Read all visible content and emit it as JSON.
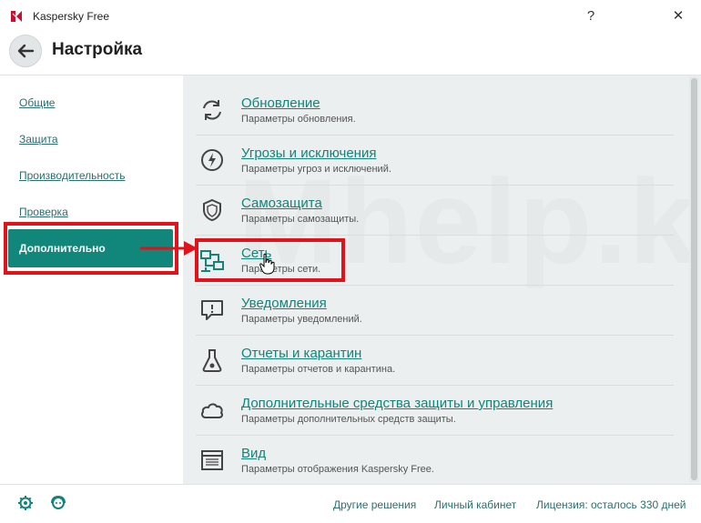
{
  "window": {
    "app_title": "Kaspersky Free",
    "help": "?",
    "close": "✕"
  },
  "header": {
    "title": "Настройка"
  },
  "sidebar": {
    "items": [
      {
        "label": "Общие"
      },
      {
        "label": "Защита"
      },
      {
        "label": "Производительность"
      },
      {
        "label": "Проверка"
      },
      {
        "label": "Дополнительно",
        "selected": true
      }
    ]
  },
  "settings": {
    "items": [
      {
        "title": "Обновление",
        "subtitle": "Параметры обновления.",
        "icon": "refresh-icon"
      },
      {
        "title": "Угрозы и исключения",
        "subtitle": "Параметры угроз и исключений.",
        "icon": "lightning-icon"
      },
      {
        "title": "Самозащита",
        "subtitle": "Параметры самозащиты.",
        "icon": "shield-icon"
      },
      {
        "title": "Сеть",
        "subtitle": "Параметры сети.",
        "icon": "network-icon"
      },
      {
        "title": "Уведомления",
        "subtitle": "Параметры уведомлений.",
        "icon": "notification-icon"
      },
      {
        "title": "Отчеты и карантин",
        "subtitle": "Параметры отчетов и карантина.",
        "icon": "flask-icon"
      },
      {
        "title": "Дополнительные средства защиты и управления",
        "subtitle": "Параметры дополнительных средств защиты.",
        "icon": "cloud-icon"
      },
      {
        "title": "Вид",
        "subtitle": "Параметры отображения Kaspersky Free.",
        "icon": "window-icon"
      }
    ]
  },
  "footer": {
    "other_solutions": "Другие решения",
    "my_account": "Личный кабинет",
    "license": "Лицензия: осталось 330 дней"
  },
  "watermark": "Mhelp.kz",
  "colors": {
    "accent": "#10877a",
    "link": "#138478",
    "annotation": "#e0121a",
    "content_bg": "#ebefef"
  }
}
